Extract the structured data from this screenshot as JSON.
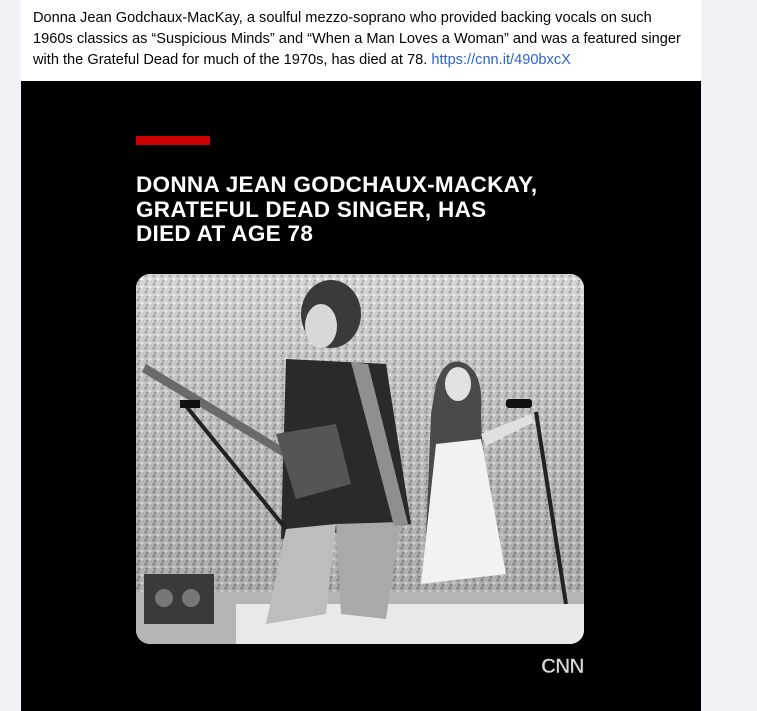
{
  "post": {
    "text_lines": [
      "Donna Jean Godchaux-MacKay, a soulful mezzo-soprano who provided backing vocals on such",
      "1960s classics as “Suspicious Minds” and “When a Man Loves a Woman” and was a featured singer",
      "with the Grateful Dead for much of the 1970s, has died at 78."
    ],
    "link": "https://cnn.it/490bxcX"
  },
  "media": {
    "headline_lines": [
      "DONNA JEAN GODCHAUX-MACKAY,",
      "GRATEFUL DEAD SINGER, HAS",
      "DIED AT AGE 78"
    ],
    "logo": "CNN",
    "accent_color": "#cc0000",
    "photo_icon": "concert-photo"
  }
}
